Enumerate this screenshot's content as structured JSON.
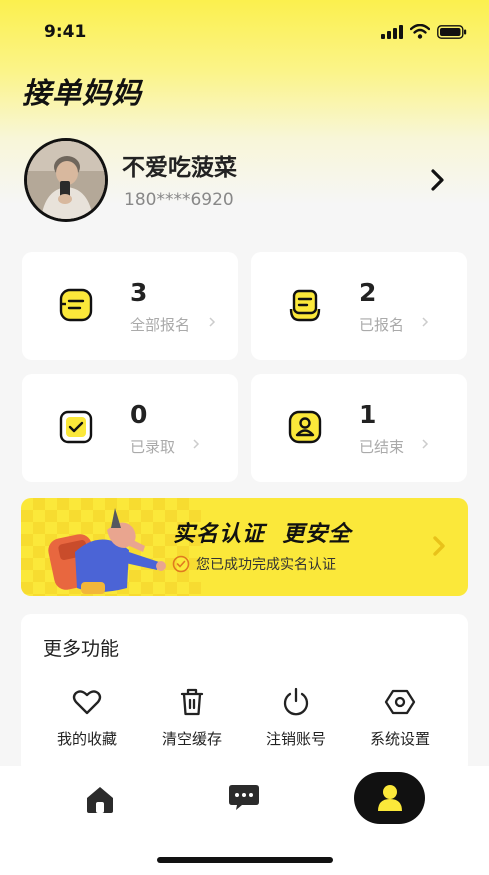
{
  "status_bar": {
    "time": "9:41"
  },
  "app": {
    "title": "接单妈妈"
  },
  "profile": {
    "name": "不爱吃菠菜",
    "phone": "180****6920"
  },
  "stats": [
    {
      "count": "3",
      "label": "全部报名",
      "icon": "document-icon"
    },
    {
      "count": "2",
      "label": "已报名",
      "icon": "clipboard-icon"
    },
    {
      "count": "0",
      "label": "已录取",
      "icon": "checkbox-icon"
    },
    {
      "count": "1",
      "label": "已结束",
      "icon": "person-icon"
    }
  ],
  "banner": {
    "title": "实名认证  更安全",
    "subtitle": "您已成功完成实名认证"
  },
  "more": {
    "title": "更多功能",
    "items": [
      {
        "label": "我的收藏",
        "icon": "heart-icon"
      },
      {
        "label": "清空缓存",
        "icon": "trash-icon"
      },
      {
        "label": "注销账号",
        "icon": "power-icon"
      },
      {
        "label": "系统设置",
        "icon": "settings-icon"
      }
    ]
  },
  "tabbar": {
    "items": [
      {
        "icon": "home-icon"
      },
      {
        "icon": "message-icon"
      },
      {
        "icon": "profile-icon",
        "active": true
      }
    ]
  },
  "colors": {
    "accent": "#fbe83a",
    "dark": "#111111"
  }
}
